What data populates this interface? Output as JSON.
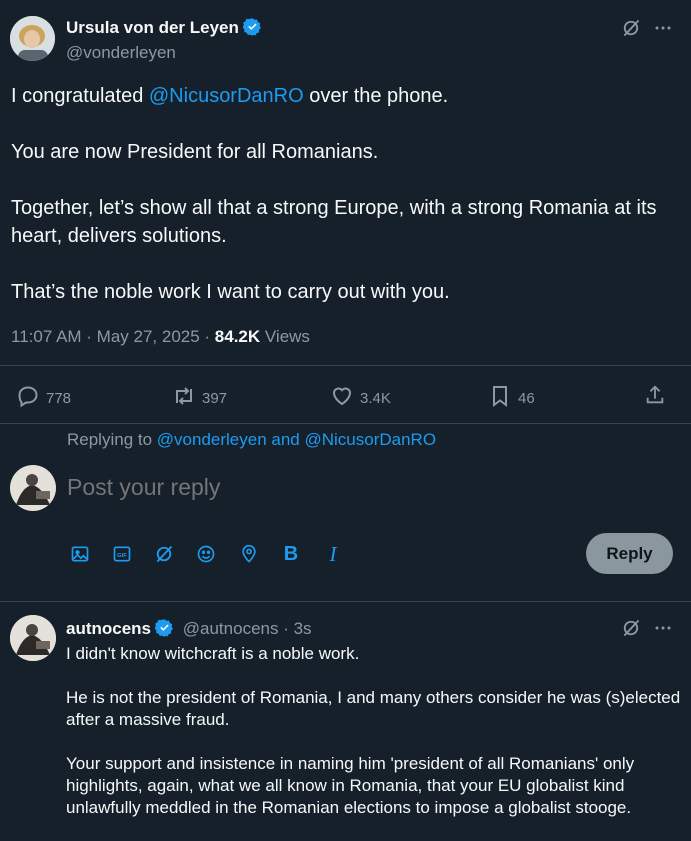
{
  "tweet": {
    "author_name": "Ursula von der Leyen",
    "author_handle": "@vonderleyen",
    "text_prefix": "I congratulated ",
    "mention": "@NicusorDanRO",
    "text_suffix": " over the phone.",
    "paragraph_2": "You are now President for all Romanians.",
    "paragraph_3": "Together, let’s show all that a strong Europe, with a strong Romania at its heart, delivers solutions.",
    "paragraph_4": "That’s the noble work I want to carry out with you.",
    "timestamp": "11:07 AM · May 27, 2025 · ",
    "views_count": "84.2K",
    "views_label": " Views"
  },
  "actions": {
    "replies": "778",
    "reposts": "397",
    "likes": "3.4K",
    "bookmarks": "46"
  },
  "composer": {
    "replying_prefix": "Replying to ",
    "replying_to": "@vonderleyen and @NicusorDanRO",
    "placeholder": "Post your reply",
    "reply_button": "Reply",
    "bold_label": "B",
    "italic_label": "I"
  },
  "reply": {
    "author_name": "autnocens",
    "author_handle": "@autnocens",
    "time": " · 3s",
    "paragraph_1": "I didn't know witchcraft is a noble work.",
    "paragraph_2": "He is not the president of Romania, I and many others consider he was (s)elected after a massive fraud.",
    "paragraph_3": "Your support and insistence in naming him 'president of all Romanians' only highlights, again, what we all know in Romania, that your EU globalist kind unlawfully meddled in the Romanian elections to impose a globalist stooge."
  },
  "colors": {
    "background": "#15202b",
    "accent": "#1d9bf0",
    "secondary_text": "#8b98a5",
    "divider": "#38444d"
  },
  "icons": [
    "verified-badge-icon",
    "grok-icon",
    "more-icon",
    "reply-icon",
    "repost-icon",
    "like-icon",
    "bookmark-icon",
    "share-icon",
    "media-icon",
    "gif-icon",
    "grok-tool-icon",
    "emoji-icon",
    "location-icon"
  ]
}
